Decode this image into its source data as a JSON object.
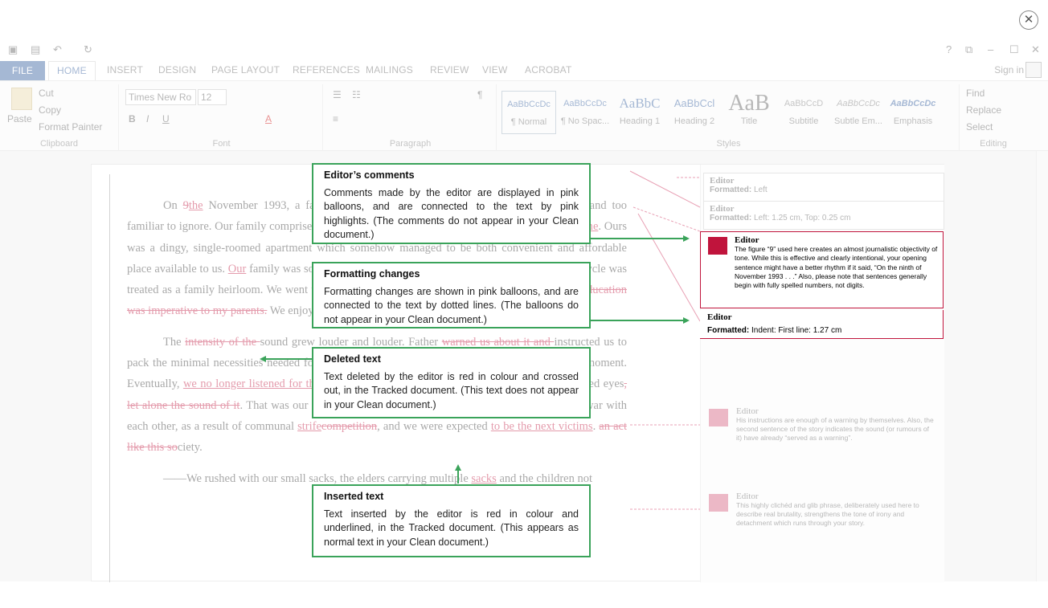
{
  "close_glyph": "✕",
  "word": {
    "qat": {
      "word_icon": "▣",
      "save_icon": "▤",
      "undo_icon": "↶",
      "redo_icon": "↻",
      "help": "?",
      "restore": "⧉",
      "minimize": "–",
      "maximize": "☐",
      "close": "✕"
    },
    "tabs": [
      "FILE",
      "HOME",
      "INSERT",
      "DESIGN",
      "PAGE LAYOUT",
      "REFERENCES",
      "MAILINGS",
      "REVIEW",
      "VIEW",
      "ACROBAT"
    ],
    "sign_in": "Sign in",
    "clipboard": {
      "paste": "Paste",
      "cut": "Cut",
      "copy": "Copy",
      "format_painter": "Format Painter",
      "label": "Clipboard"
    },
    "font": {
      "name": "Times New Ro",
      "size": "12",
      "label": "Font"
    },
    "paragraph": {
      "label": "Paragraph"
    },
    "styles": {
      "label": "Styles",
      "items": [
        {
          "sample": "AaBbCcDc",
          "name": "¶ Normal"
        },
        {
          "sample": "AaBbCcDc",
          "name": "¶ No Spac..."
        },
        {
          "sample": "AaBbC",
          "name": "Heading 1"
        },
        {
          "sample": "AaBbCcl",
          "name": "Heading 2"
        },
        {
          "sample": "AaB",
          "name": "Title"
        },
        {
          "sample": "AaBbCcD",
          "name": "Subtitle"
        },
        {
          "sample": "AaBbCcDc",
          "name": "Subtle Em..."
        },
        {
          "sample": "AaBbCcDc",
          "name": "Emphasis"
        }
      ]
    },
    "editing": {
      "find": "Find",
      "replace": "Replace",
      "select": "Select",
      "label": "Editing"
    }
  },
  "document": {
    "markup": {
      "fmt1": {
        "who": "Editor",
        "label": "Formatted:",
        "value": "Left"
      },
      "fmt2": {
        "who": "Editor",
        "label": "Formatted:",
        "value": "Left:  1.25 cm, Top:  0.25 cm"
      },
      "comment2": {
        "who": "Editor",
        "text": "His instructions are enough of a warning by themselves. Also, the second sentence of the story indicates the sound (or rumours of it) have already “served as a warning”."
      },
      "comment3": {
        "who": "Editor",
        "text": "This highly clichéd and glib phrase, deliberately used here to describe real brutality, strengthens the tone of irony and detachment which runs through your story."
      }
    }
  },
  "highlight": {
    "comment": {
      "who": "Editor",
      "text": "The figure “9” used here creates an almost journalistic objectivity of tone. While this is effective and clearly intentional, your opening sentence might have a better rhythm if it said, “On the ninth of November 1993 . . .” Also, please note that sentences generally begin with fully spelled numbers, not digits."
    },
    "formatted": {
      "who": "Editor",
      "label": "Formatted:",
      "value": "Indent: First line:  1.27 cm"
    }
  },
  "callouts": [
    {
      "title": "Editor’s comments",
      "body": "Comments made by the editor are displayed in pink balloons, and are connected to the text by pink highlights. (The comments do not appear in your Clean document.)"
    },
    {
      "title": "Formatting changes",
      "body": "Formatting changes are shown in pink balloons, and are connected to the text by dotted lines. (The balloons do not appear in your Clean document.)"
    },
    {
      "title": "Deleted text",
      "body": "Text deleted by the editor is red in colour and crossed out, in the Tracked document. (This text does not appear in your Clean document.)"
    },
    {
      "title": "Inserted text",
      "body": "Text inserted by the editor is red in colour and underlined, in the Tracked document. (This appears as normal text in your Clean document.)"
    }
  ],
  "colors": {
    "callout_border": "#3aa35a",
    "track_red": "#c0143c",
    "word_blue": "#2b579a"
  }
}
